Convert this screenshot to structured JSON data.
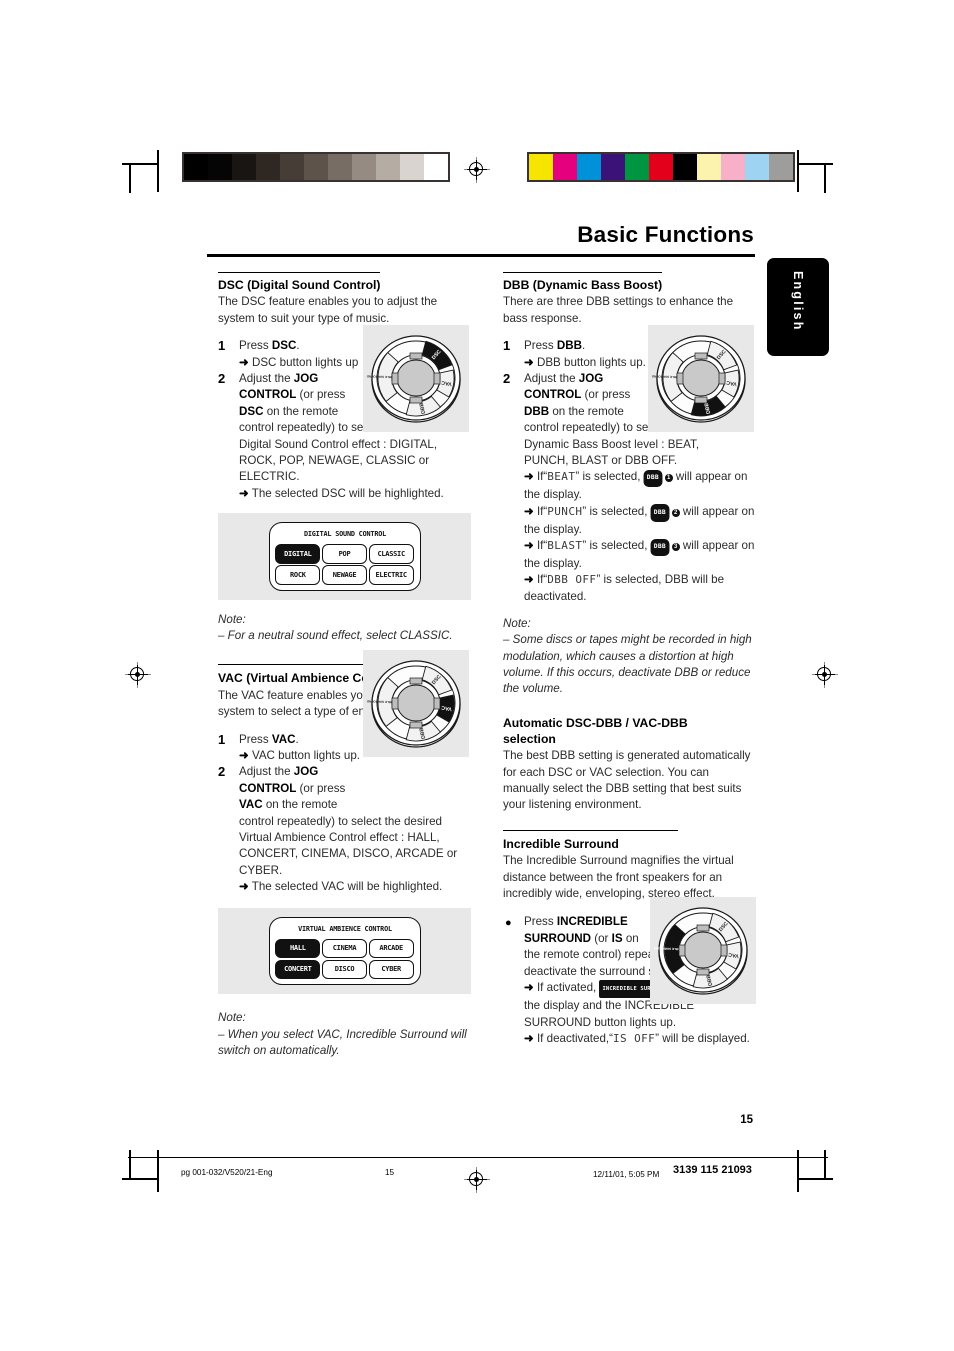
{
  "page": {
    "title": "Basic Functions",
    "language_tab": "English",
    "page_number": "15"
  },
  "printer_marks": {
    "grayscale_swatches": [
      "#000000",
      "#050505",
      "#191512",
      "#2e2722",
      "#463d36",
      "#5d534b",
      "#786d64",
      "#968b82",
      "#b5aca4",
      "#d9d4cf",
      "#ffffff"
    ],
    "color_swatches": [
      "#f5e500",
      "#e5007d",
      "#0091d8",
      "#3b1278",
      "#009540",
      "#e3001b",
      "#000000",
      "#fbf3ae",
      "#f8b0c8",
      "#9ed4f2",
      "#9d9d9c"
    ]
  },
  "left_column": {
    "dsc": {
      "heading": "DSC (Digital Sound Control)",
      "intro": "The DSC feature enables you to adjust the system to suit your type of music.",
      "step1_num": "1",
      "step1_text_a": "Press ",
      "step1_kw": "DSC",
      "step1_text_b": ".",
      "step1_result": "DSC button lights up",
      "step2_num": "2",
      "step2_line1_a": "Adjust the ",
      "step2_kw1": "JOG",
      "step2_kw2": "CONTROL",
      "step2_line2_b": " (or press",
      "step2_kw3": "DSC",
      "step2_line3_b": " on the remote",
      "step2_rest": "control repeatedly) to select the desired Digital Sound Control effect : DIGITAL, ROCK, POP, NEWAGE, CLASSIC or ELECTRIC.",
      "step2_result": "The selected DSC will be highlighted.",
      "note_label": "Note:",
      "note_text": "–  For a neutral sound effect, select CLASSIC.",
      "display": {
        "header": "DIGITAL SOUND CONTROL",
        "row1": [
          "DIGITAL",
          "POP",
          "CLASSIC"
        ],
        "row2": [
          "ROCK",
          "NEWAGE",
          "ELECTRIC"
        ]
      }
    },
    "vac": {
      "heading": "VAC (Virtual Ambience Control)",
      "intro": "The VAC feature enables you to adjust the system to select a type of environment.",
      "step1_num": "1",
      "step1_text_a": "Press ",
      "step1_kw": "VAC",
      "step1_text_b": ".",
      "step1_result": "VAC button lights up.",
      "step2_num": "2",
      "step2_line1_a": "Adjust the ",
      "step2_kw1": "JOG",
      "step2_kw2": "CONTROL",
      "step2_line2_b": " (or press",
      "step2_kw3": "VAC",
      "step2_line3_b": " on the remote",
      "step2_rest": "control repeatedly) to select the desired Virtual Ambience Control effect : HALL, CONCERT, CINEMA, DISCO, ARCADE or CYBER.",
      "step2_result": "The selected VAC will be highlighted.",
      "note_label": "Note:",
      "note_text": "–  When you select VAC, Incredible Surround will switch on automatically.",
      "display": {
        "header": "VIRTUAL AMBIENCE CONTROL",
        "row1": [
          "HALL",
          "CINEMA",
          "ARCADE"
        ],
        "row2": [
          "CONCERT",
          "DISCO",
          "CYBER"
        ]
      }
    }
  },
  "right_column": {
    "dbb": {
      "heading": "DBB (Dynamic Bass Boost)",
      "intro": "There are three DBB settings to enhance the bass response.",
      "step1_num": "1",
      "step1_text_a": "Press ",
      "step1_kw": "DBB",
      "step1_text_b": ".",
      "step1_result": "DBB button lights up.",
      "step2_num": "2",
      "step2_line1_a": "Adjust the ",
      "step2_kw1": "JOG",
      "step2_kw2": "CONTROL",
      "step2_line2_b": " (or press",
      "step2_kw3": "DBB",
      "step2_line3_b": " on the remote",
      "step2_rest": "control repeatedly) to select the desired Dynamic Bass Boost level : BEAT,",
      "step2_rest2": "PUNCH, BLAST or DBB OFF.",
      "result_beat_pre": "If“",
      "result_beat_lcd": "BEAT",
      "result_beat_mid": "” is selected, ",
      "badge_label": "DBB",
      "result_beat_num": "1",
      "result_beat_post": " will appear on the display.",
      "result_punch_lcd": "PUNCH",
      "result_punch_num": "2",
      "result_blast_lcd": "BLAST",
      "result_blast_num": "3",
      "result_off_lcd": "DBB OFF",
      "result_off_post": "” is selected, DBB will be deactivated.",
      "note_label": "Note:",
      "note_text": "–  Some discs or tapes might be recorded in high modulation, which causes a distortion at high volume. If this occurs, deactivate DBB or reduce the volume."
    },
    "auto": {
      "heading_line1": "Automatic DSC-DBB / VAC-DBB",
      "heading_line2": "selection",
      "body": "The best DBB setting is generated automatically for each DSC or VAC selection. You can manually select the DBB setting that best suits your listening environment."
    },
    "surround": {
      "heading": "Incredible Surround",
      "intro": "The Incredible Surround magnifies the virtual distance between the front speakers for an incredibly wide, enveloping, stereo effect.",
      "bullet": "●",
      "step_a": "Press ",
      "step_kw1": "INCREDIBLE",
      "step_kw2": "SURROUND",
      "step_mid": " (or ",
      "step_kw3": "IS",
      "step_mid2": " on",
      "step_rest": "the remote control) repeatedly to activate/ deactivate the surround sound effect.",
      "result1_pre": "If activated, ",
      "result1_badge": "INCREDIBLE SURROUND",
      "result1_post": " will appear on the display and the INCREDIBLE SURROUND button lights up.",
      "result2_pre": "If deactivated,“",
      "result2_lcd": "IS OFF",
      "result2_post": "” will be displayed."
    }
  },
  "wheel": {
    "labels": {
      "dsc": "DSC",
      "vac": "VAC",
      "dbb": "DBB",
      "surround": "INCREDIBLE SURROUND"
    }
  },
  "footer": {
    "file": "pg 001-032/V520/21-Eng",
    "page": "15",
    "timestamp": "12/11/01, 5:05 PM",
    "code": "3139 115 21093"
  }
}
